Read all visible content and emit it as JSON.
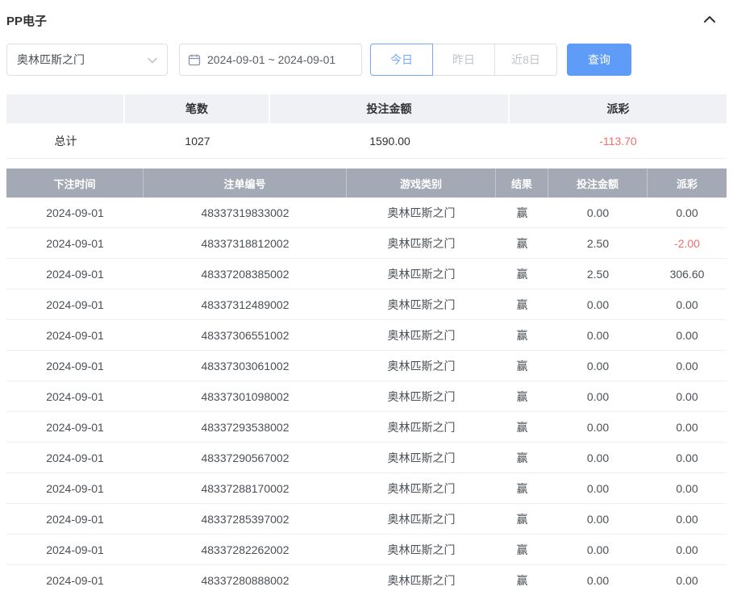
{
  "panel": {
    "title": "PP电子"
  },
  "filters": {
    "game_select": {
      "value": "奥林匹斯之门"
    },
    "date_range": "2024-09-01 ~ 2024-09-01",
    "quick_buttons": [
      {
        "label": "今日",
        "active": true
      },
      {
        "label": "昨日",
        "active": false
      },
      {
        "label": "近8日",
        "active": false
      }
    ],
    "query_label": "查询"
  },
  "summary": {
    "headers": [
      "",
      "笔数",
      "投注金额",
      "派彩"
    ],
    "row_label": "总计",
    "count": "1027",
    "bet_amount": "1590.00",
    "payout": "-113.70"
  },
  "table": {
    "headers": [
      "下注时间",
      "注单编号",
      "游戏类别",
      "结果",
      "投注金额",
      "派彩"
    ],
    "rows": [
      {
        "date": "2024-09-01",
        "order_id": "48337319833002",
        "game": "奥林匹斯之门",
        "result": "赢",
        "bet": "0.00",
        "payout": "0.00"
      },
      {
        "date": "2024-09-01",
        "order_id": "48337318812002",
        "game": "奥林匹斯之门",
        "result": "赢",
        "bet": "2.50",
        "payout": "-2.00"
      },
      {
        "date": "2024-09-01",
        "order_id": "48337208385002",
        "game": "奥林匹斯之门",
        "result": "赢",
        "bet": "2.50",
        "payout": "306.60"
      },
      {
        "date": "2024-09-01",
        "order_id": "48337312489002",
        "game": "奥林匹斯之门",
        "result": "赢",
        "bet": "0.00",
        "payout": "0.00"
      },
      {
        "date": "2024-09-01",
        "order_id": "48337306551002",
        "game": "奥林匹斯之门",
        "result": "赢",
        "bet": "0.00",
        "payout": "0.00"
      },
      {
        "date": "2024-09-01",
        "order_id": "48337303061002",
        "game": "奥林匹斯之门",
        "result": "赢",
        "bet": "0.00",
        "payout": "0.00"
      },
      {
        "date": "2024-09-01",
        "order_id": "48337301098002",
        "game": "奥林匹斯之门",
        "result": "赢",
        "bet": "0.00",
        "payout": "0.00"
      },
      {
        "date": "2024-09-01",
        "order_id": "48337293538002",
        "game": "奥林匹斯之门",
        "result": "赢",
        "bet": "0.00",
        "payout": "0.00"
      },
      {
        "date": "2024-09-01",
        "order_id": "48337290567002",
        "game": "奥林匹斯之门",
        "result": "赢",
        "bet": "0.00",
        "payout": "0.00"
      },
      {
        "date": "2024-09-01",
        "order_id": "48337288170002",
        "game": "奥林匹斯之门",
        "result": "赢",
        "bet": "0.00",
        "payout": "0.00"
      },
      {
        "date": "2024-09-01",
        "order_id": "48337285397002",
        "game": "奥林匹斯之门",
        "result": "赢",
        "bet": "0.00",
        "payout": "0.00"
      },
      {
        "date": "2024-09-01",
        "order_id": "48337282262002",
        "game": "奥林匹斯之门",
        "result": "赢",
        "bet": "0.00",
        "payout": "0.00"
      },
      {
        "date": "2024-09-01",
        "order_id": "48337280888002",
        "game": "奥林匹斯之门",
        "result": "赢",
        "bet": "0.00",
        "payout": "0.00"
      }
    ]
  },
  "colors": {
    "accent": "#5e9cf8",
    "negative": "#f56c6c",
    "table_header_bg": "#a4aab5"
  }
}
